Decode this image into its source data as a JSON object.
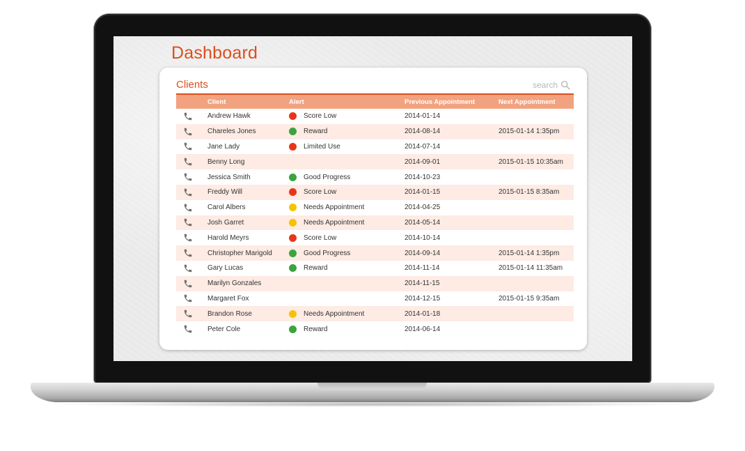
{
  "dashboard": {
    "title": "Dashboard"
  },
  "clients": {
    "title": "Clients",
    "search_placeholder": "search",
    "columns": [
      "Client",
      "Alert",
      "Previous Appointment",
      "Next Appointment"
    ],
    "rows": [
      {
        "client": "Andrew Hawk",
        "alert": "Score Low",
        "alert_color": "#e8351a",
        "prev": "2014-01-14",
        "next": ""
      },
      {
        "client": "Chareles Jones",
        "alert": "Reward",
        "alert_color": "#3aa43e",
        "prev": "2014-08-14",
        "next": "2015-01-14 1:35pm"
      },
      {
        "client": "Jane Lady",
        "alert": "Limited Use",
        "alert_color": "#e8351a",
        "prev": "2014-07-14",
        "next": ""
      },
      {
        "client": "Benny Long",
        "alert": "",
        "alert_color": "",
        "prev": "2014-09-01",
        "next": "2015-01-15 10:35am"
      },
      {
        "client": "Jessica Smith",
        "alert": "Good Progress",
        "alert_color": "#3aa43e",
        "prev": "2014-10-23",
        "next": ""
      },
      {
        "client": "Freddy Will",
        "alert": "Score Low",
        "alert_color": "#e8351a",
        "prev": "2014-01-15",
        "next": "2015-01-15 8:35am"
      },
      {
        "client": "Carol Albers",
        "alert": "Needs Appointment",
        "alert_color": "#f5c300",
        "prev": "2014-04-25",
        "next": ""
      },
      {
        "client": "Josh Garret",
        "alert": "Needs Appointment",
        "alert_color": "#f5c300",
        "prev": "2014-05-14",
        "next": ""
      },
      {
        "client": "Harold Meyrs",
        "alert": "Score Low",
        "alert_color": "#e8351a",
        "prev": "2014-10-14",
        "next": ""
      },
      {
        "client": "Christopher Marigold",
        "alert": "Good Progress",
        "alert_color": "#3aa43e",
        "prev": "2014-09-14",
        "next": "2015-01-14 1:35pm"
      },
      {
        "client": "Gary Lucas",
        "alert": "Reward",
        "alert_color": "#3aa43e",
        "prev": "2014-11-14",
        "next": "2015-01-14 11:35am"
      },
      {
        "client": "Marilyn Gonzales",
        "alert": "",
        "alert_color": "",
        "prev": "2014-11-15",
        "next": ""
      },
      {
        "client": "Margaret Fox",
        "alert": "",
        "alert_color": "",
        "prev": "2014-12-15",
        "next": "2015-01-15 9:35am"
      },
      {
        "client": "Brandon Rose",
        "alert": "Needs Appointment",
        "alert_color": "#f5c300",
        "prev": "2014-01-18",
        "next": ""
      },
      {
        "client": "Peter Cole",
        "alert": "Reward",
        "alert_color": "#3aa43e",
        "prev": "2014-06-14",
        "next": ""
      }
    ]
  },
  "colors": {
    "accent": "#d9501f",
    "header_bg": "#f2a27f",
    "row_alt_bg": "#fdebe4",
    "status_red": "#e8351a",
    "status_green": "#3aa43e",
    "status_yellow": "#f5c300"
  },
  "icons": {
    "row_action": "phone-icon",
    "search": "search-icon"
  }
}
